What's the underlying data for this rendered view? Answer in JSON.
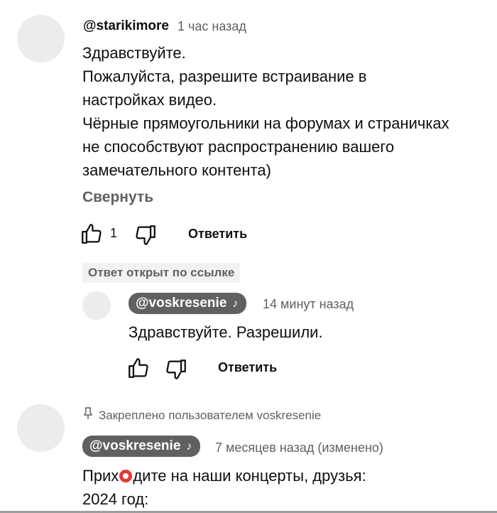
{
  "comment1": {
    "handle": "@starikimore",
    "time": "1 час назад",
    "lines": [
      "Здравствуйте.",
      "Пожалуйста, разрешите встраивание в",
      "настройках видео.",
      "Чёрные прямоугольники на форумах и страничках",
      "не способствуют распространению вашего",
      "замечательного контента)"
    ],
    "collapse_label": "Свернуть",
    "like_count": "1",
    "reply_label": "Ответить",
    "icons": [
      "thumb-up-icon",
      "thumb-down-icon"
    ]
  },
  "linked_badge": "Ответ открыт по ссылке",
  "reply1": {
    "handle": "@voskresenie",
    "badge_icon": "music-note-icon",
    "time": "14 минут назад",
    "text": "Здравствуйте. Разрешили.",
    "reply_label": "Ответить"
  },
  "comment2": {
    "pinned_icon": "pin-icon",
    "pinned_text": "Закреплено пользователем voskresenie",
    "handle": "@voskresenie",
    "badge_icon": "music-note-icon",
    "time": "7 месяцев назад (изменено)",
    "line1_before": "Прих",
    "line1_after": "дите на наши концерты, друзья:",
    "line2": "2024 год:"
  },
  "colors": {
    "avatar": "#ececec",
    "chip": "#606060",
    "secondary_text": "#606060",
    "accent_red": "#e53935"
  }
}
